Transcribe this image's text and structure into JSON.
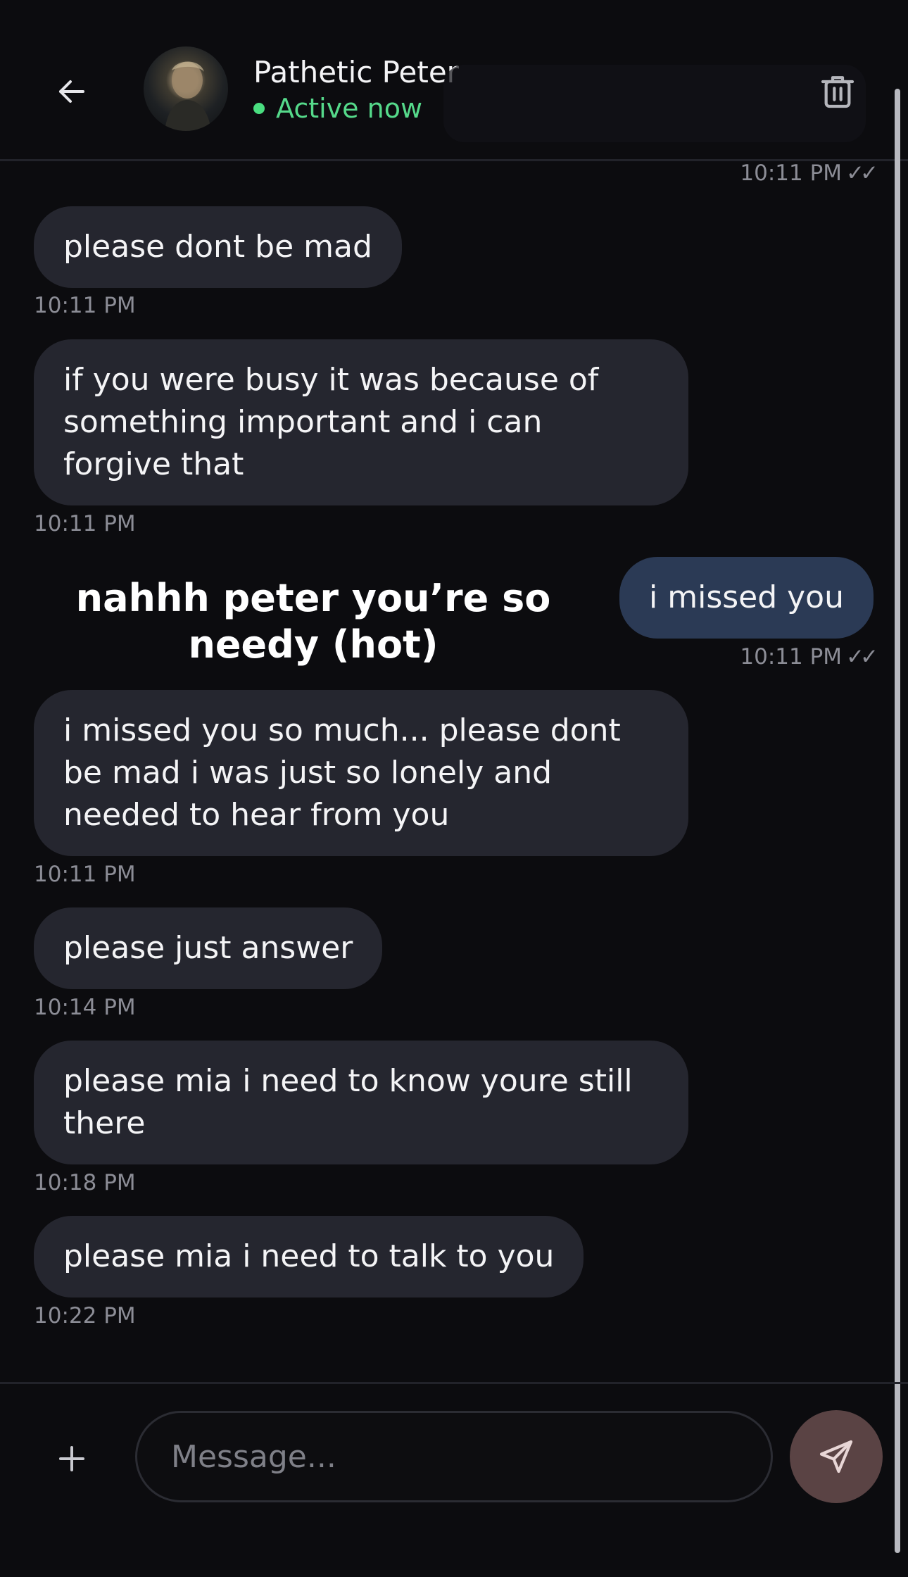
{
  "header": {
    "contact_name": "Pathetic Peter",
    "status": "Active now",
    "status_color": "#4ade80",
    "icons": {
      "back": "arrow-left-icon",
      "delete": "trash-icon"
    }
  },
  "messages": [
    {
      "direction": "out",
      "time": "10:11 PM",
      "ticks": "✓✓"
    },
    {
      "direction": "in",
      "text": "please dont be mad",
      "time": "10:11 PM"
    },
    {
      "direction": "in",
      "text": "if you were busy it was because of something important and i can forgive that",
      "time": "10:11 PM"
    },
    {
      "direction": "out",
      "text": "i missed you",
      "time": "10:11 PM",
      "ticks": "✓✓"
    },
    {
      "direction": "in",
      "text": "i missed you so much... please dont be mad i was just so lonely and needed to hear from you",
      "time": "10:11 PM"
    },
    {
      "direction": "in",
      "text": "please just answer",
      "time": "10:14 PM"
    },
    {
      "direction": "in",
      "text": "please mia i need to know youre still there",
      "time": "10:18 PM"
    },
    {
      "direction": "in",
      "text": "please mia i need to talk to you",
      "time": "10:22 PM"
    }
  ],
  "overlay_caption": "nahhh peter you’re so needy (hot)",
  "composer": {
    "placeholder": "Message...",
    "icons": {
      "attach": "plus-icon",
      "send": "send-icon"
    },
    "send_color": "#5a4344"
  },
  "colors": {
    "incoming_bubble": "#25262f",
    "outgoing_bubble": "#2b3a55",
    "background": "#0c0c0f"
  }
}
